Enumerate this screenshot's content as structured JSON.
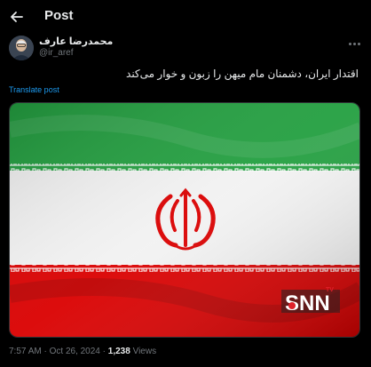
{
  "header": {
    "title": "Post",
    "back_icon": "arrow-left-icon"
  },
  "author": {
    "name": "محمدرضا عارف",
    "handle": "@ir_aref"
  },
  "post": {
    "text": "اقتدار ایران، دشمنان مام میهن را زبون و خوار می‌کند",
    "translate_label": "Translate post"
  },
  "media": {
    "description_icon": "iran-flag-image",
    "watermark_text": "SNN",
    "watermark_sub": "TV",
    "flag_colors": {
      "green": "#239f40",
      "white": "#f2f2f2",
      "red": "#da0000"
    }
  },
  "meta": {
    "time": "7:57 AM",
    "separator": "·",
    "date": "Oct 26, 2024",
    "views_count": "1,238",
    "views_label": "Views"
  },
  "colors": {
    "background": "#000000",
    "text": "#e7e9ea",
    "muted": "#71767b",
    "accent": "#1d9bf0"
  }
}
